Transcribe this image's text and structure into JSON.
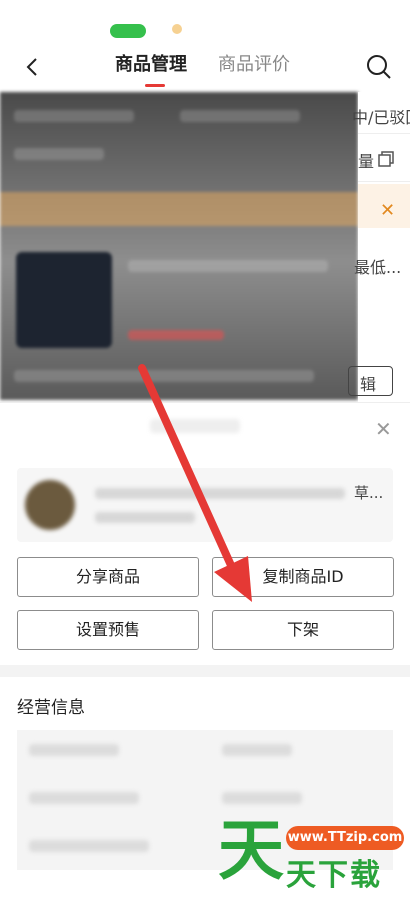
{
  "header": {
    "tabs": [
      {
        "label": "商品管理",
        "active": true
      },
      {
        "label": "商品评价",
        "active": false
      }
    ]
  },
  "edge_fragments": {
    "status": "中/已驳回",
    "action": "量",
    "item_title": "最低...",
    "edit": "辑",
    "card_title": "草..."
  },
  "actions": [
    {
      "label": "分享商品"
    },
    {
      "label": "复制商品ID"
    },
    {
      "label": "设置预售"
    },
    {
      "label": "下架"
    }
  ],
  "business": {
    "title": "经营信息"
  },
  "watermark": {
    "glyph": "天",
    "url": "www.TTzip.com",
    "text": "天下载"
  },
  "colors": {
    "annotation_arrow": "#e53935",
    "watermark_green": "#2aa33b",
    "watermark_orange": "#ee5b23"
  }
}
